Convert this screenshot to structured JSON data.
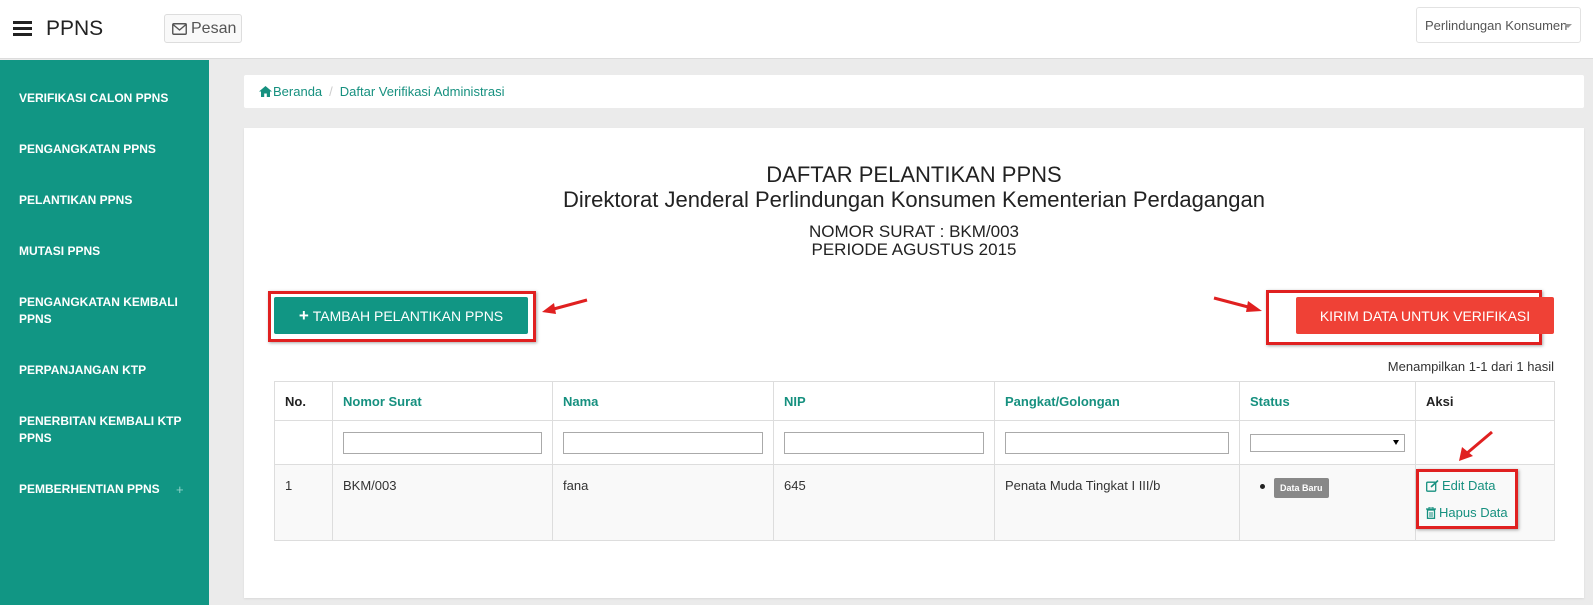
{
  "header": {
    "brand": "PPNS",
    "message_button": "Pesan",
    "dept_select": "Perlindungan Konsumen"
  },
  "sidebar": {
    "items": [
      {
        "label": "VERIFIKASI CALON PPNS"
      },
      {
        "label": "PENGANGKATAN PPNS"
      },
      {
        "label": "PELANTIKAN PPNS"
      },
      {
        "label": "MUTASI PPNS"
      },
      {
        "label": "PENGANGKATAN KEMBALI PPNS"
      },
      {
        "label": "PERPANJANGAN KTP"
      },
      {
        "label": "PENERBITAN KEMBALI KTP PPNS"
      },
      {
        "label": "PEMBERHENTIAN PPNS"
      }
    ],
    "expand_symbol": "+"
  },
  "breadcrumb": {
    "home": "Beranda",
    "current": "Daftar Verifikasi Administrasi"
  },
  "panel": {
    "title": "DAFTAR PELANTIKAN PPNS",
    "subtitle": "Direktorat Jenderal Perlindungan Konsumen Kementerian Perdagangan",
    "letter_number": "NOMOR SURAT : BKM/003",
    "period": "PERIODE AGUSTUS 2015",
    "add_button": "TAMBAH PELANTIKAN PPNS",
    "add_symbol": "+",
    "send_button": "KIRIM DATA UNTUK VERIFIKASI",
    "result_count": "Menampilkan 1-1 dari 1 hasil"
  },
  "table": {
    "columns": [
      "No.",
      "Nomor Surat",
      "Nama",
      "NIP",
      "Pangkat/Golongan",
      "Status",
      "Aksi"
    ],
    "rows": [
      {
        "no": "1",
        "nomor_surat": "BKM/003",
        "nama": "fana",
        "nip": "645",
        "pangkat": "Penata Muda Tingkat I III/b",
        "status": "Data Baru",
        "actions": [
          "Edit Data",
          "Hapus Data"
        ]
      }
    ]
  },
  "colors": {
    "teal": "#119684",
    "link_teal": "#16907f",
    "red_button": "#ef4136",
    "highlight_red": "#e02020",
    "badge_gray": "#888888"
  },
  "icons": [
    "menu-icon",
    "envelope-icon",
    "home-icon",
    "edit-icon",
    "trash-icon",
    "arrow-annotation-icon"
  ]
}
